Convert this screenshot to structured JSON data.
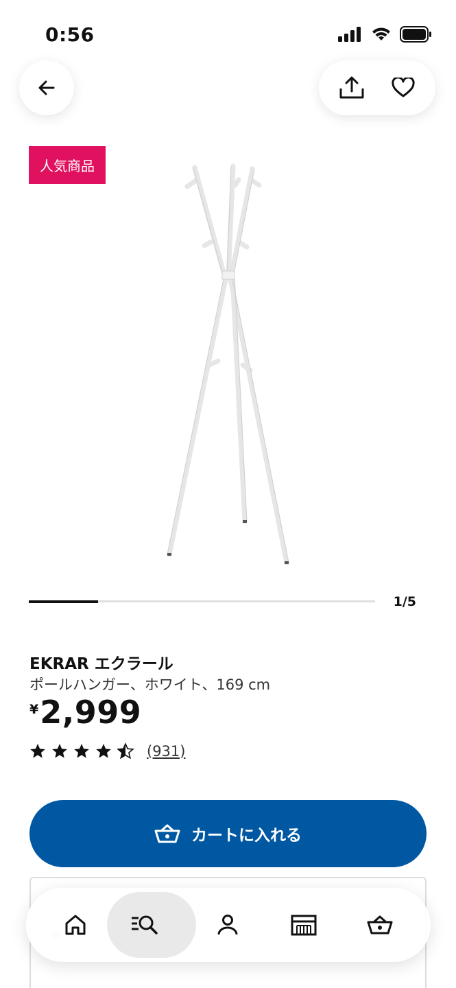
{
  "status_bar": {
    "time": "0:56"
  },
  "header": {
    "back_icon": "arrow-left-icon",
    "share_icon": "share-icon",
    "favorite_icon": "heart-icon"
  },
  "badge": {
    "label": "人気商品",
    "color": "#e0115f"
  },
  "gallery": {
    "page_indicator": "1/5",
    "progress": 0.2
  },
  "product": {
    "name": "EKRAR エクラール",
    "description": "ポールハンガー、ホワイト、169 cm",
    "currency": "¥",
    "price": "2,999",
    "rating": 4.5,
    "rating_count": "(931)"
  },
  "cart_button": {
    "label": "カートに入れる",
    "color": "#0058a3"
  },
  "bottom_nav": {
    "items": [
      {
        "icon": "home-icon"
      },
      {
        "icon": "search-icon",
        "active": true
      },
      {
        "icon": "profile-icon"
      },
      {
        "icon": "store-icon"
      },
      {
        "icon": "cart-icon"
      }
    ]
  }
}
